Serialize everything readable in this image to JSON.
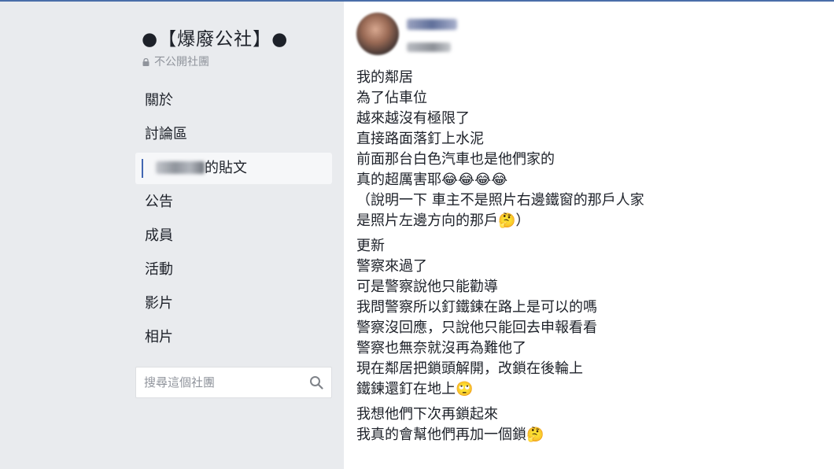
{
  "group": {
    "title": "●【爆廢公社】●",
    "privacy": "不公開社團"
  },
  "nav": {
    "items": [
      {
        "label": "關於"
      },
      {
        "label": "討論區"
      },
      {
        "label": "的貼文"
      },
      {
        "label": "公告"
      },
      {
        "label": "成員"
      },
      {
        "label": "活動"
      },
      {
        "label": "影片"
      },
      {
        "label": "相片"
      }
    ]
  },
  "search": {
    "placeholder": "搜尋這個社團"
  },
  "post": {
    "paragraphs": [
      {
        "lines": [
          "我的鄰居",
          "為了佔車位",
          "越來越沒有極限了",
          "直接路面落釘上水泥",
          "前面那台白色汽車也是他們家的",
          "真的超厲害耶😂😂😂😂",
          "（說明一下 車主不是照片右邊鐵窗的那戶人家",
          "是照片左邊方向的那戶🤔）"
        ]
      },
      {
        "lines": [
          "更新",
          "警察來過了",
          "可是警察說他只能勸導",
          "我問警察所以釘鐵鍊在路上是可以的嗎",
          "警察沒回應，只說他只能回去申報看看",
          "警察也無奈就沒再為難他了",
          "現在鄰居把鎖頭解開，改鎖在後輪上",
          "鐵鍊還釘在地上🙄"
        ]
      },
      {
        "lines": [
          "我想他們下次再鎖起來",
          "我真的會幫他們再加一個鎖🤔"
        ]
      }
    ]
  }
}
